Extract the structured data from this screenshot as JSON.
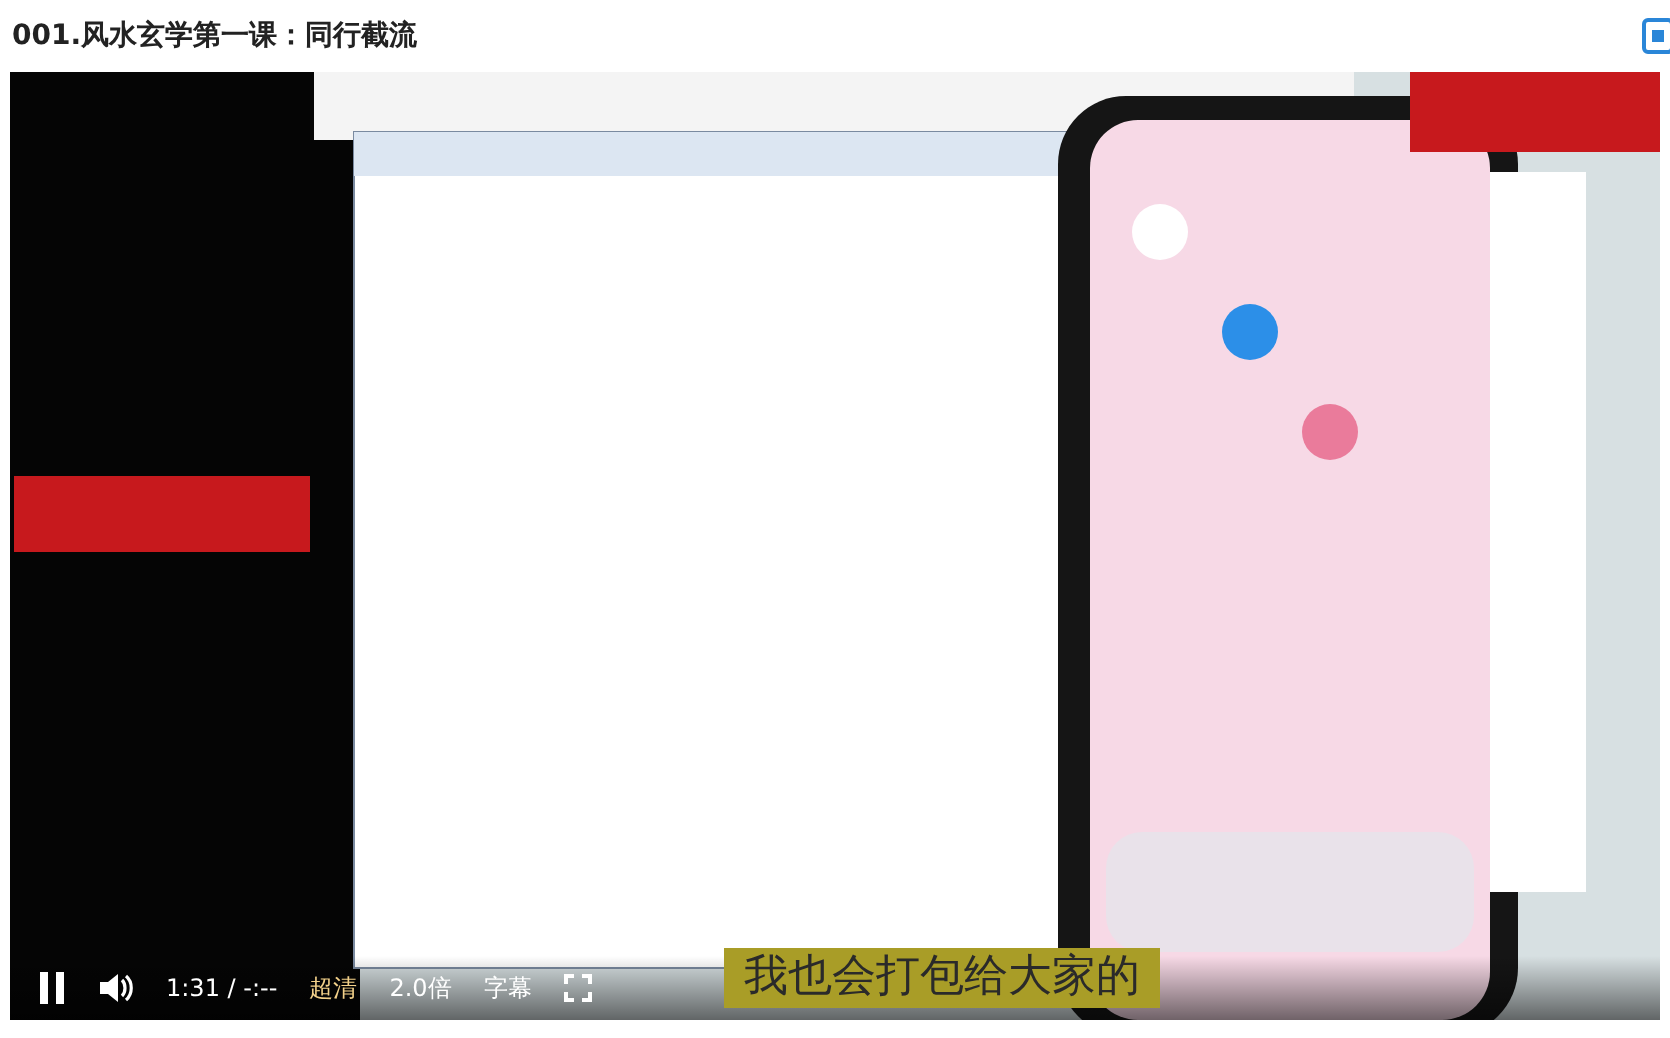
{
  "title": "001.风水玄学第一课：同行截流",
  "player": {
    "playing": true,
    "time": "1:31",
    "separator": "/",
    "duration": "-:--",
    "quality": "超清",
    "speed": "2.0倍",
    "subtitles_button": "字幕",
    "caption": "我也会打包给大家的"
  }
}
